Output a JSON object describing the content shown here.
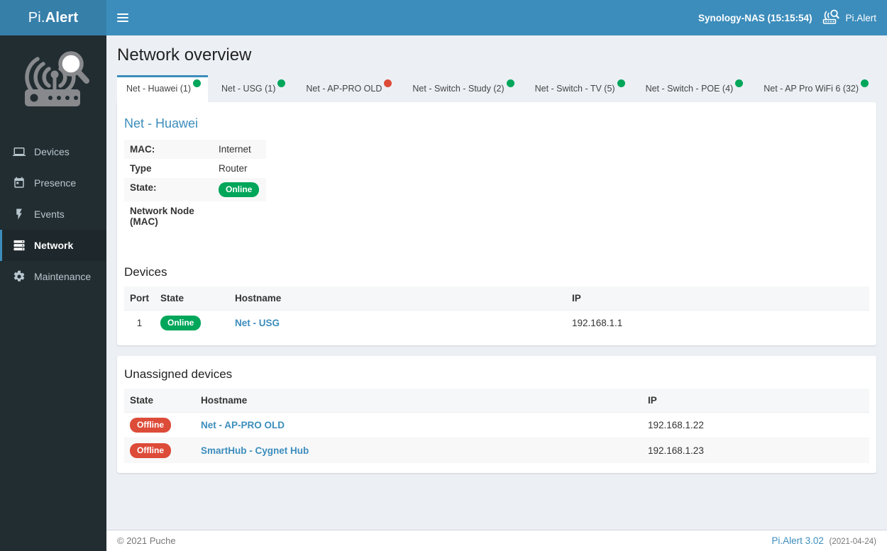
{
  "header": {
    "logo_pre": "Pi.",
    "logo_bold": "Alert",
    "status": "Synology-NAS (15:15:54)",
    "brand": "Pi.Alert"
  },
  "sidebar": {
    "items": [
      {
        "label": "Devices"
      },
      {
        "label": "Presence"
      },
      {
        "label": "Events"
      },
      {
        "label": "Network"
      },
      {
        "label": "Maintenance"
      }
    ]
  },
  "page": {
    "title": "Network overview"
  },
  "tabs": [
    {
      "label": "Net - Huawei (1)",
      "dot": "green",
      "active": true
    },
    {
      "label": "Net - USG (1)",
      "dot": "green",
      "active": false
    },
    {
      "label": "Net - AP-PRO OLD",
      "dot": "red",
      "active": false
    },
    {
      "label": "Net - Switch - Study (2)",
      "dot": "green",
      "active": false
    },
    {
      "label": "Net - Switch - TV (5)",
      "dot": "green",
      "active": false
    },
    {
      "label": "Net - Switch - POE (4)",
      "dot": "green",
      "active": false
    },
    {
      "label": "Net - AP Pro WiFi 6 (32)",
      "dot": "green",
      "active": false
    }
  ],
  "node": {
    "title": "Net - Huawei",
    "rows": [
      {
        "label": "MAC:",
        "value": "Internet"
      },
      {
        "label": "Type",
        "value": "Router"
      },
      {
        "label": "State:",
        "value": "Online"
      },
      {
        "label": "Network Node (MAC)",
        "value": ""
      }
    ]
  },
  "devices": {
    "heading": "Devices",
    "columns": [
      "Port",
      "State",
      "Hostname",
      "IP"
    ],
    "rows": [
      {
        "port": "1",
        "state": "Online",
        "hostname": "Net - USG",
        "ip": "192.168.1.1"
      }
    ]
  },
  "unassigned": {
    "heading": "Unassigned devices",
    "columns": [
      "State",
      "Hostname",
      "IP"
    ],
    "rows": [
      {
        "state": "Offline",
        "hostname": "Net - AP-PRO OLD",
        "ip": "192.168.1.22"
      },
      {
        "state": "Offline",
        "hostname": "SmartHub - Cygnet Hub",
        "ip": "192.168.1.23"
      }
    ]
  },
  "footer": {
    "copyright": "© 2021 Puche",
    "version": "Pi.Alert  3.02",
    "date": "(2021-04-24)"
  },
  "colors": {
    "accent": "#3c8dbc",
    "header_logo_bg": "#367fa9",
    "sidebar_bg": "#222d32",
    "online": "#00a65a",
    "offline": "#dd4b39"
  }
}
